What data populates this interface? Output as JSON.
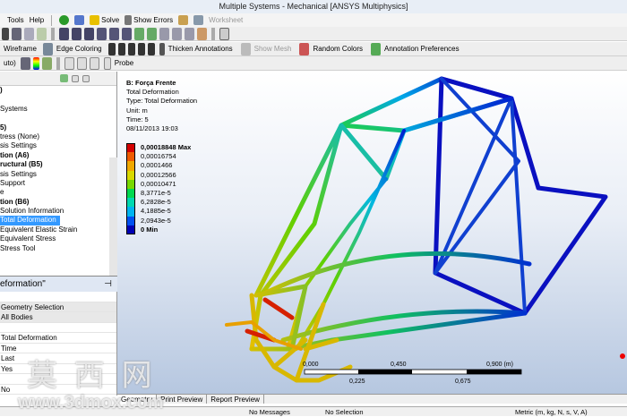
{
  "window": {
    "title": "Multiple Systems - Mechanical [ANSYS Multiphysics]"
  },
  "menu": [
    "Tools",
    "Help"
  ],
  "toolbar1": {
    "solve": "Solve",
    "show_errors": "Show Errors",
    "worksheet": "Worksheet"
  },
  "toolbar2": {
    "wireframe": "Wireframe",
    "edge_coloring": "Edge Coloring",
    "thicken": "Thicken Annotations",
    "show_mesh": "Show Mesh",
    "random_colors": "Random Colors",
    "annotation_prefs": "Annotation Preferences"
  },
  "toolbar3": {
    "scale": "uto)",
    "probe": "Probe"
  },
  "tree": {
    "items": [
      {
        "text": ")",
        "bold": true
      },
      {
        "text": "",
        "bold": false
      },
      {
        "text": "Systems",
        "bold": false
      },
      {
        "text": "",
        "bold": false
      },
      {
        "text": "5)",
        "bold": true
      },
      {
        "text": "tress (None)",
        "bold": false
      },
      {
        "text": "sis Settings",
        "bold": false
      },
      {
        "text": "tion (A6)",
        "bold": true
      },
      {
        "text": "ructural (B5)",
        "bold": true
      },
      {
        "text": "sis Settings",
        "bold": false
      },
      {
        "text": "Support",
        "bold": false
      },
      {
        "text": "e",
        "bold": false
      },
      {
        "text": "tion (B6)",
        "bold": true
      },
      {
        "text": "Solution Information",
        "bold": false
      },
      {
        "text": "Total Deformation",
        "bold": false,
        "selected": true
      },
      {
        "text": "Equivalent Elastic Strain",
        "bold": false
      },
      {
        "text": "Equivalent Stress",
        "bold": false
      },
      {
        "text": "Stress Tool",
        "bold": false
      }
    ]
  },
  "details": {
    "title": "eformation\"",
    "rows": [
      {
        "text": "",
        "header": false
      },
      {
        "text": "Geometry Selection",
        "header": true
      },
      {
        "text": "All Bodies",
        "header": true
      },
      {
        "text": "",
        "header": false
      },
      {
        "text": "Total Deformation",
        "header": false
      },
      {
        "text": "Time",
        "header": false
      },
      {
        "text": "Last",
        "header": false
      },
      {
        "text": "Yes",
        "header": false
      },
      {
        "text": "",
        "header": false
      },
      {
        "text": "No",
        "header": false
      }
    ]
  },
  "result": {
    "name": "B: Força Frente",
    "type_title": "Total Deformation",
    "type": "Type: Total Deformation",
    "unit": "Unit: m",
    "time": "Time: 5",
    "date": "08/11/2013 19:03"
  },
  "legend": [
    {
      "label": "0,00018848 Max",
      "color": "#d40000",
      "bold": true
    },
    {
      "label": "0,00016754",
      "color": "#ee5a00",
      "bold": false
    },
    {
      "label": "0,0001466",
      "color": "#f0a800",
      "bold": false
    },
    {
      "label": "0,00012566",
      "color": "#d8d800",
      "bold": false
    },
    {
      "label": "0,00010471",
      "color": "#78d800",
      "bold": false
    },
    {
      "label": "8,3771e-5",
      "color": "#00d850",
      "bold": false
    },
    {
      "label": "6,2828e-5",
      "color": "#00d8b0",
      "bold": false
    },
    {
      "label": "4,1885e-5",
      "color": "#00b4f0",
      "bold": false
    },
    {
      "label": "2,0943e-5",
      "color": "#0050f0",
      "bold": false
    },
    {
      "label": "0 Min",
      "color": "#0000b4",
      "bold": true
    }
  ],
  "scale": {
    "top": [
      "0,000",
      "0,450",
      "0,900 (m)"
    ],
    "bottom": [
      "0,225",
      "0,675"
    ]
  },
  "tabs": [
    "Geometry",
    "Print Preview",
    "Report Preview"
  ],
  "status": {
    "messages": "No Messages",
    "selection": "No Selection",
    "units": "Metric (m, kg, N, s, V, A)"
  },
  "watermark": {
    "chars": "莫 西 网",
    "url": "www.3dmox.com"
  }
}
